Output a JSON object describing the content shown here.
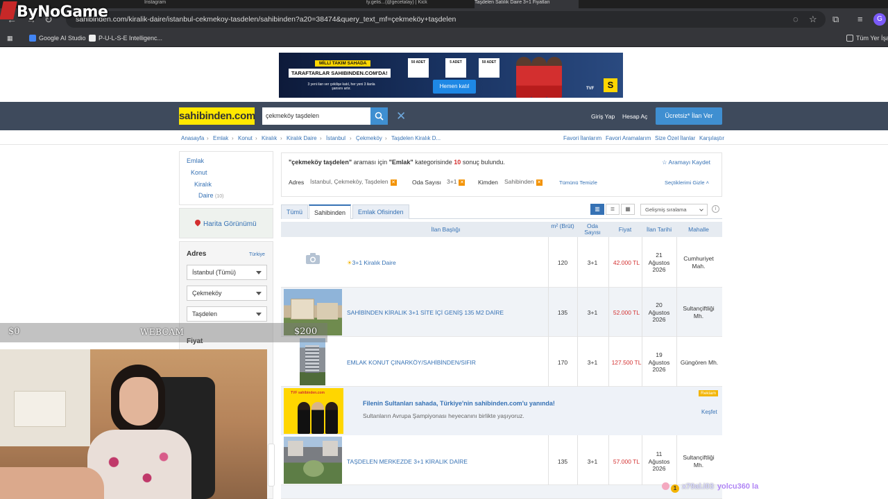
{
  "browser": {
    "tabs": [
      "",
      "Instagram",
      "",
      "",
      "ty.gelis...(@gecetalay) | Kick",
      "Taşdelen Satılık Daire 3+1 Fiyatları"
    ],
    "url": "sahibinden.com/kiralik-daire/istanbul-cekmekoy-tasdelen/sahibinden?a20=38474&query_text_mf=çekmeköy+taşdelen",
    "bookmarks": [
      "Google AI Studio",
      "P-U-L-S-E Intelligenc...",
      "Tüm Yer İşaretleri"
    ],
    "profile_initial": "G"
  },
  "overlay": {
    "logo_text": "ByNoGame",
    "left_value": "$0",
    "webcam_label": "WEBCAM",
    "right_value": "$200"
  },
  "banner": {
    "tag": "MİLLİ TAKIM SAHADA",
    "headline": "TARAFTARLAR SAHIBINDEN.COM'DA!",
    "sub": "3 yeni ilan ver çekilişe katıl, her yeni 3 ilanla şansını artır.",
    "box1": "50 ADET",
    "box2": "5 ADET",
    "box3": "50 ADET",
    "button": "Hemen katıl",
    "org": "TVF",
    "brand": "S"
  },
  "header": {
    "logo": "sahibinden.com",
    "search_value": "çekmeköy taşdelen",
    "login": "Giriş Yap",
    "signup": "Hesap Aç",
    "cta": "Ücretsiz* İlan Ver"
  },
  "breadcrumb": [
    "Anasayfa",
    "Emlak",
    "Konut",
    "Kiralık",
    "Kiralık Daire",
    "İstanbul",
    "Çekmeköy",
    "Taşdelen Kiralık D..."
  ],
  "util_links": [
    "Favori İlanlarım",
    "Favori Aramalarım",
    "Size Özel İlanlar",
    "Karşılaştır"
  ],
  "sidebar": {
    "categories": [
      "Emlak",
      "Konut",
      "Kiralık",
      "Daire"
    ],
    "daire_count": "(10)",
    "map_label": "Harita Görünümü",
    "address_label": "Adres",
    "country_link": "Türkiye",
    "selects": [
      "İstanbul (Tümü)",
      "Çekmeköy",
      "Taşdelen"
    ],
    "price_label": "Fiyat"
  },
  "summary": {
    "query": "\"çekmeköy taşdelen\"",
    "q_mid": "araması için",
    "category": "\"Emlak\"",
    "q_tail": "kategorisinde",
    "count": "10",
    "q_end": "sonuç bulundu.",
    "save": "Aramayı Kaydet",
    "address_label": "Adres",
    "address_value": "İstanbul, Çekmeköy, Taşdelen",
    "rooms_label": "Oda Sayısı",
    "rooms_value": "3+1",
    "from_label": "Kimden",
    "from_value": "Sahibinden",
    "reset": "Tümünü Temizle",
    "hide": "Seçtiklerimi Gizle"
  },
  "tabs": [
    "Tümü",
    "Sahibinden",
    "Emlak Ofisinden"
  ],
  "sort": "Gelişmiş sıralama",
  "table": {
    "headers": [
      "İlan Başlığı",
      "m² (Brüt)",
      "Oda Sayısı",
      "Fiyat",
      "İlan Tarihi",
      "Mahalle"
    ],
    "rows": [
      {
        "title": "3+1 Kiralık Daire",
        "m2": "120",
        "rooms": "3+1",
        "price": "42.000 TL",
        "d1": "21",
        "d2": "Ağustos",
        "d3": "2026",
        "n1": "Cumhuriyet",
        "n2": "Mah."
      },
      {
        "title": "SAHİBİNDEN KİRALIK 3+1 SİTE İÇİ GENİŞ 135 M2 DAİRE",
        "m2": "135",
        "rooms": "3+1",
        "price": "52.000 TL",
        "d1": "20",
        "d2": "Ağustos",
        "d3": "2026",
        "n1": "Sultançiftliği",
        "n2": "Mh."
      },
      {
        "title": "EMLAK KONUT ÇINARKÖY/SAHİBİNDEN/SIFIR",
        "m2": "170",
        "rooms": "3+1",
        "price": "127.500 TL",
        "d1": "19",
        "d2": "Ağustos",
        "d3": "2026",
        "n1": "Güngören Mh.",
        "n2": ""
      },
      {
        "title": "TAŞDELEN MERKEZDE 3+1 KİRALIK DAİRE",
        "m2": "135",
        "rooms": "3+1",
        "price": "57.000 TL",
        "d1": "11",
        "d2": "Ağustos",
        "d3": "2026",
        "n1": "Sultançiftliği",
        "n2": "Mh."
      }
    ]
  },
  "ad": {
    "image_caption": "TVF sahibinden.com",
    "headline": "Filenin Sultanları sahada, Türkiye'nin sahibinden.com'u yanında!",
    "sub": "Sultanların Avrupa Şampiyonası heyecanını birlikte yaşıyoruz.",
    "badge": "Reklam",
    "cta": "Keşfet"
  },
  "chat": {
    "user": "x79al.i03",
    "message": "yolcu360 la"
  }
}
